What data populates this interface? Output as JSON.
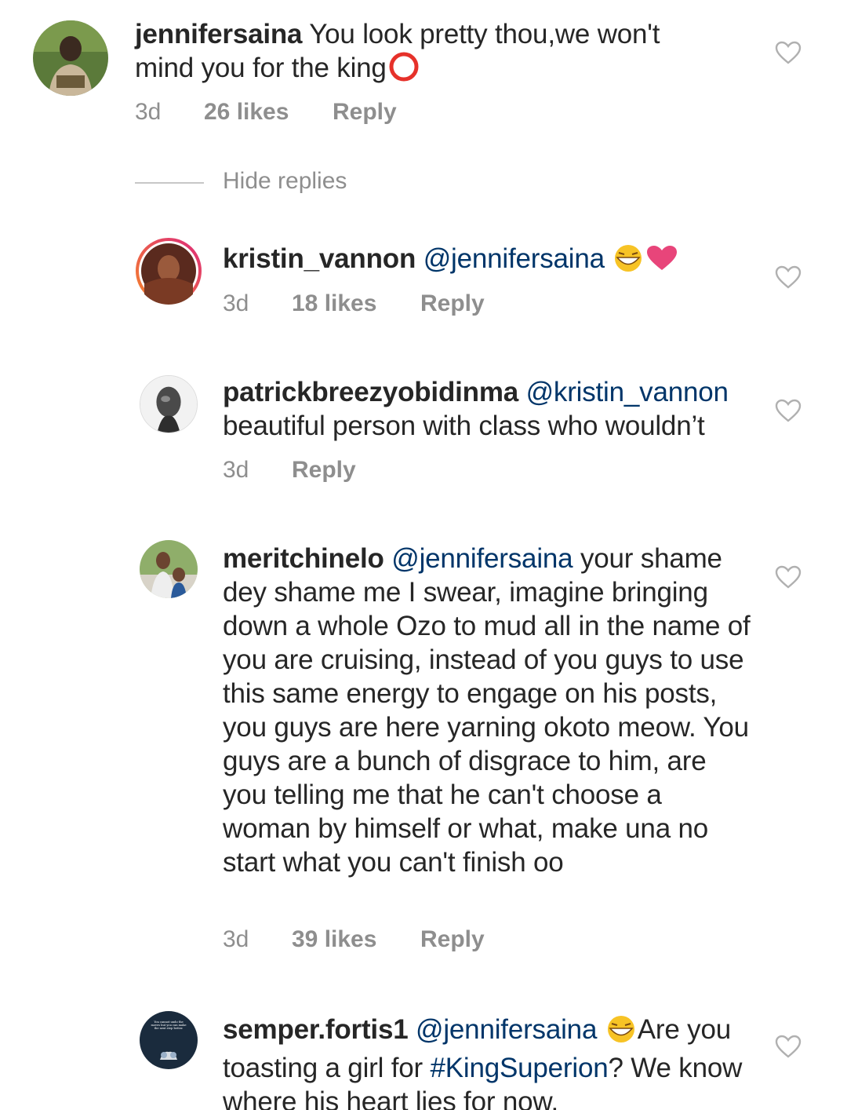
{
  "comments": [
    {
      "username": "jennifersaina",
      "text": " You look pretty thou,we won't mind you for the king",
      "time": "3d",
      "likes": "26 likes",
      "reply": "Reply"
    }
  ],
  "hide_replies": "Hide replies",
  "replies": [
    {
      "username": "kristin_vannon",
      "mention": "@jennifersaina",
      "time": "3d",
      "likes": "18 likes",
      "reply": "Reply"
    },
    {
      "username": "patrickbreezyobidinma",
      "mention": "@kristin_vannon",
      "text": "beautiful person with class who wouldn’t",
      "time": "3d",
      "reply": "Reply"
    },
    {
      "username": "meritchinelo",
      "mention": "@jennifersaina",
      "text": " your shame dey shame me I swear, imagine bringing down a whole Ozo to mud all in the name of you are cruising, instead of you guys to use this same energy to engage on his posts, you guys are here yarning okoto meow. You guys are a bunch of disgrace to him, are you telling me that he can't choose a woman by himself or what, make una no start what you can't finish oo",
      "time": "3d",
      "likes": "39 likes",
      "reply": "Reply"
    },
    {
      "username": "semper.fortis1",
      "mention": "@jennifersaina",
      "text_a": "Are you toasting a girl for ",
      "hashtag": "#KingSuperion",
      "text_b": "? We know where his heart lies for now.",
      "avatar_text": "You cannot undo the moves but you can make the next step better."
    }
  ],
  "colors": {
    "text": "#262626",
    "muted": "#8e8e8e",
    "link": "#003569",
    "story_ring_start": "#f58529",
    "story_ring_end": "#dd2a7b"
  }
}
